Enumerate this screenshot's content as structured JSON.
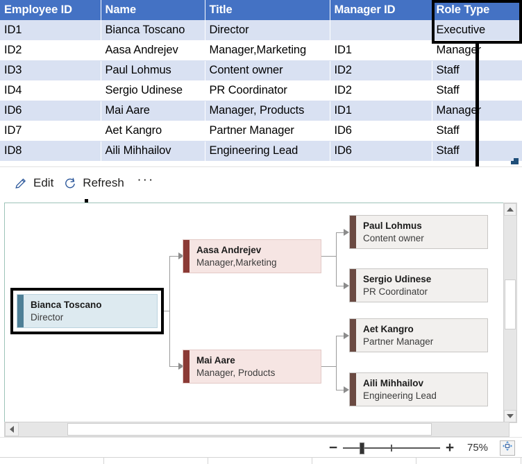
{
  "table": {
    "columns": [
      "Employee ID",
      "Name",
      "Title",
      "Manager ID",
      "Role Type"
    ],
    "rows": [
      {
        "id": "ID1",
        "name": "Bianca Toscano",
        "title": "Director",
        "manager": "",
        "role": "Executive"
      },
      {
        "id": "ID2",
        "name": "Aasa Andrejev",
        "title": "Manager,Marketing",
        "manager": "ID1",
        "role": "Manager"
      },
      {
        "id": "ID3",
        "name": "Paul Lohmus",
        "title": "Content owner",
        "manager": "ID2",
        "role": "Staff"
      },
      {
        "id": "ID4",
        "name": "Sergio Udinese",
        "title": "PR Coordinator",
        "manager": "ID2",
        "role": "Staff"
      },
      {
        "id": "ID6",
        "name": "Mai Aare",
        "title": "Manager, Products",
        "manager": "ID1",
        "role": "Manager"
      },
      {
        "id": "ID7",
        "name": "Aet Kangro",
        "title": "Partner Manager",
        "manager": "ID6",
        "role": "Staff"
      },
      {
        "id": "ID8",
        "name": "Aili Mihhailov",
        "title": "Engineering Lead",
        "manager": "ID6",
        "role": "Staff"
      }
    ],
    "header_color": "#4472C4",
    "alt_row_color": "#D9E1F2"
  },
  "toolbar": {
    "edit_label": "Edit",
    "refresh_label": "Refresh",
    "overflow_label": "···"
  },
  "orgchart": {
    "nodes": {
      "bianca": {
        "name": "Bianca Toscano",
        "title": "Director",
        "selected": true
      },
      "aasa": {
        "name": "Aasa Andrejev",
        "title": "Manager,Marketing",
        "selected": false
      },
      "mai": {
        "name": "Mai Aare",
        "title": "Manager, Products",
        "selected": false
      },
      "paul": {
        "name": "Paul Lohmus",
        "title": "Content owner",
        "selected": false
      },
      "sergio": {
        "name": "Sergio Udinese",
        "title": "PR Coordinator",
        "selected": false
      },
      "aet": {
        "name": "Aet Kangro",
        "title": "Partner Manager",
        "selected": false
      },
      "aili": {
        "name": "Aili Mihhailov",
        "title": "Engineering Lead",
        "selected": false
      }
    },
    "colors": {
      "executive_fill": "#DDEAF0",
      "executive_accent": "#4E7F96",
      "manager_fill": "#F6E5E3",
      "manager_accent": "#8B3A35",
      "staff_fill": "#F2F0EE",
      "staff_accent": "#6B4A42",
      "canvas_border": "#9DC3B8",
      "callout": "#000000"
    }
  },
  "statusbar": {
    "zoom_out_label": "−",
    "zoom_in_label": "+",
    "zoom_percent": "75%"
  }
}
